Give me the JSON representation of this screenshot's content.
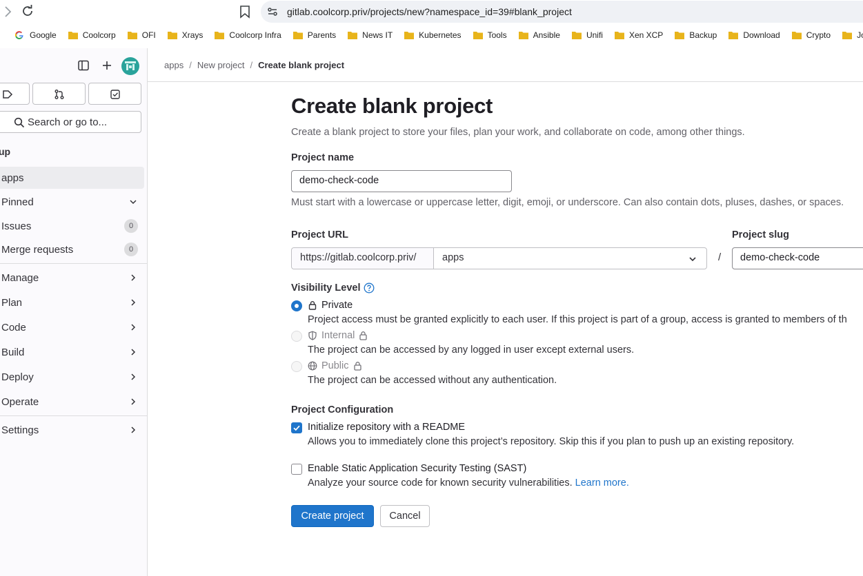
{
  "browser": {
    "url": "gitlab.coolcorp.priv/projects/new?namespace_id=39#blank_project",
    "bookmarks": [
      "Google",
      "Coolcorp",
      "OFI",
      "Xrays",
      "Coolcorp Infra",
      "Parents",
      "News IT",
      "Kubernetes",
      "Tools",
      "Ansible",
      "Unifi",
      "Xen XCP",
      "Backup",
      "Download",
      "Crypto",
      "Jou"
    ]
  },
  "sidebar": {
    "search_label": "Search or go to...",
    "group_heading": "up",
    "items": [
      {
        "label": "apps"
      },
      {
        "label": "Pinned"
      },
      {
        "label": "Issues",
        "count": "0"
      },
      {
        "label": "Merge requests",
        "count": "0"
      },
      {
        "label": "Manage"
      },
      {
        "label": "Plan"
      },
      {
        "label": "Code"
      },
      {
        "label": "Build"
      },
      {
        "label": "Deploy"
      },
      {
        "label": "Operate"
      },
      {
        "label": "Settings"
      }
    ]
  },
  "breadcrumb": [
    "apps",
    "New project",
    "Create blank project"
  ],
  "page": {
    "title": "Create blank project",
    "description": "Create a blank project to store your files, plan your work, and collaborate on code, among other things.",
    "project_name_label": "Project name",
    "project_name_value": "demo-check-code",
    "project_name_help": "Must start with a lowercase or uppercase letter, digit, emoji, or underscore. Can also contain dots, pluses, dashes, or spaces.",
    "project_url_label": "Project URL",
    "url_prefix": "https://gitlab.coolcorp.priv/",
    "url_namespace": "apps",
    "slash": "/",
    "project_slug_label": "Project slug",
    "project_slug_value": "demo-check-code",
    "visibility_label": "Visibility Level",
    "visibility_options": [
      {
        "label": "Private",
        "desc": "Project access must be granted explicitly to each user. If this project is part of a group, access is granted to members of th",
        "selected": true
      },
      {
        "label": "Internal",
        "desc": "The project can be accessed by any logged in user except external users.",
        "selected": false
      },
      {
        "label": "Public",
        "desc": "The project can be accessed without any authentication.",
        "selected": false
      }
    ],
    "config_label": "Project Configuration",
    "readme_label": "Initialize repository with a README",
    "readme_desc": "Allows you to immediately clone this project’s repository. Skip this if you plan to push up an existing repository.",
    "sast_label": "Enable Static Application Security Testing (SAST)",
    "sast_desc": "Analyze your source code for known security vulnerabilities.",
    "learn_more": "Learn more.",
    "create_button": "Create project",
    "cancel_button": "Cancel"
  }
}
